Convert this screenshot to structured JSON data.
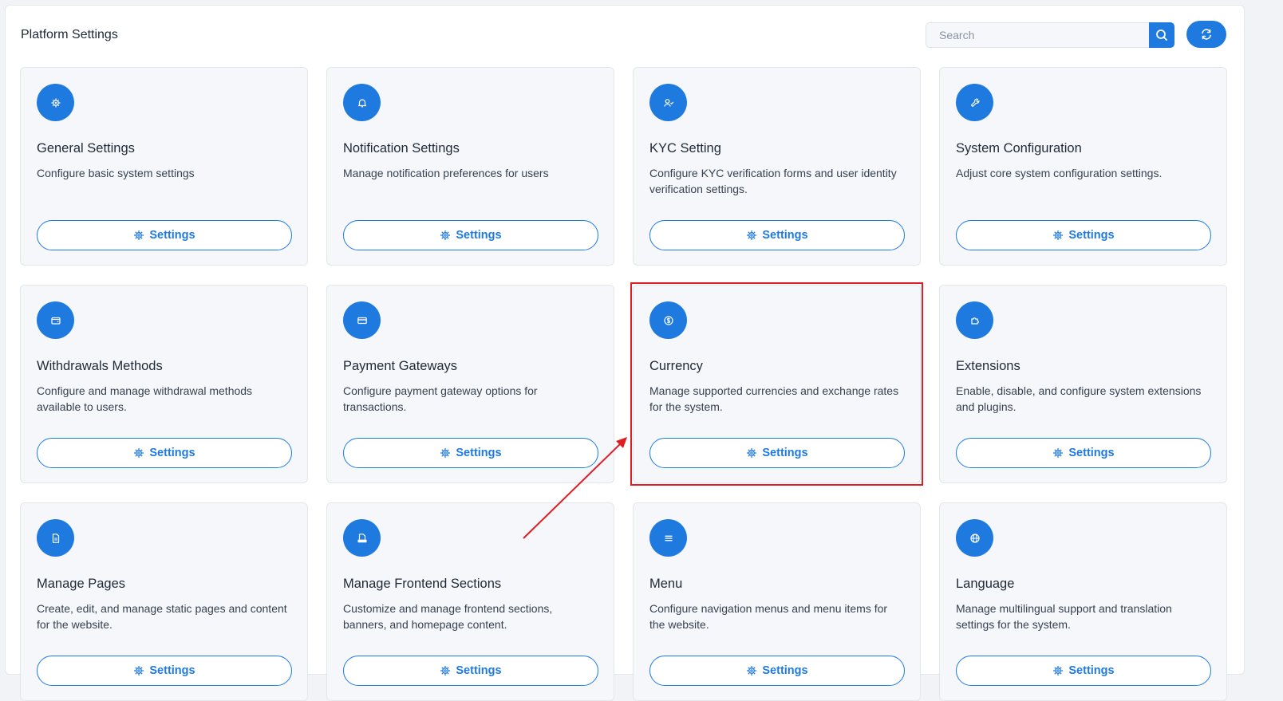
{
  "header": {
    "title": "Platform Settings",
    "search_placeholder": "Search",
    "search_value": ""
  },
  "colors": {
    "accent": "#1f7ae0",
    "annotation": "#e11d23"
  },
  "cards": [
    {
      "icon": "gear-icon",
      "title": "General Settings",
      "desc": "Configure basic system settings",
      "button": "Settings"
    },
    {
      "icon": "bell-icon",
      "title": "Notification Settings",
      "desc": "Manage notification preferences for users",
      "button": "Settings"
    },
    {
      "icon": "user-check-icon",
      "title": "KYC Setting",
      "desc": "Configure KYC verification forms and user identity verification settings.",
      "button": "Settings"
    },
    {
      "icon": "wrench-icon",
      "title": "System Configuration",
      "desc": "Adjust core system configuration settings.",
      "button": "Settings"
    },
    {
      "icon": "wallet-icon",
      "title": "Withdrawals Methods",
      "desc": "Configure and manage withdrawal methods available to users.",
      "button": "Settings"
    },
    {
      "icon": "credit-card-icon",
      "title": "Payment Gateways",
      "desc": "Configure payment gateway options for transactions.",
      "button": "Settings"
    },
    {
      "icon": "dollar-icon",
      "title": "Currency",
      "desc": "Manage supported currencies and exchange rates for the system.",
      "button": "Settings"
    },
    {
      "icon": "puzzle-icon",
      "title": "Extensions",
      "desc": "Enable, disable, and configure system extensions and plugins.",
      "button": "Settings"
    },
    {
      "icon": "document-icon",
      "title": "Manage Pages",
      "desc": "Create, edit, and manage static pages and content for the website.",
      "button": "Settings"
    },
    {
      "icon": "html-icon",
      "title": "Manage Frontend Sections",
      "desc": "Customize and manage frontend sections, banners, and homepage content.",
      "button": "Settings"
    },
    {
      "icon": "menu-icon",
      "title": "Menu",
      "desc": "Configure navigation menus and menu items for the website.",
      "button": "Settings"
    },
    {
      "icon": "globe-icon",
      "title": "Language",
      "desc": "Manage multilingual support and translation settings for the system.",
      "button": "Settings"
    }
  ]
}
